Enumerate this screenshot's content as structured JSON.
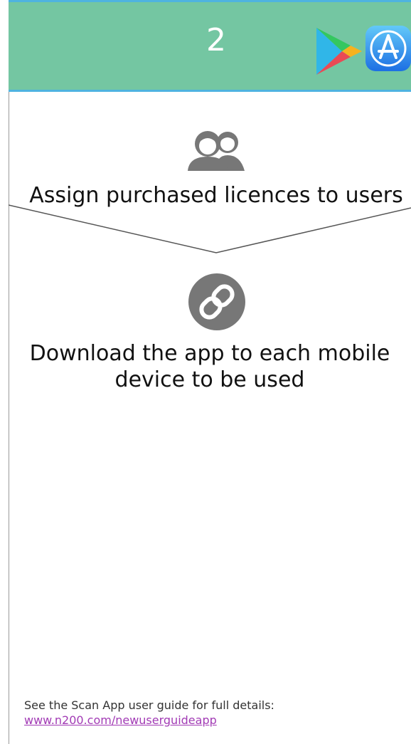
{
  "header": {
    "step_number": "2",
    "icons": [
      "google-play-icon",
      "app-store-icon"
    ],
    "background_color": "#74c6a2",
    "border_color": "#4fb3e0"
  },
  "steps": [
    {
      "icon": "users-icon",
      "text": "Assign purchased licences to users"
    },
    {
      "icon": "link-icon",
      "text": "Download the app to each mobile device to be used"
    }
  ],
  "footer": {
    "text": "See the Scan App user guide for full details:",
    "link_text": "www.n200.com/newuserguideapp"
  },
  "colors": {
    "icon_gray": "#777777",
    "link": "#a23bb5"
  }
}
